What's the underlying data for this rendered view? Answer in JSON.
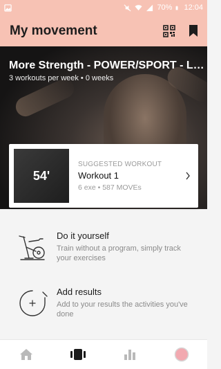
{
  "status_bar": {
    "battery": "70%",
    "time": "12:04",
    "icons": [
      "gallery-icon",
      "mute-icon",
      "wifi-icon",
      "signal-icon",
      "battery-icon"
    ]
  },
  "app_bar": {
    "title": "My movement",
    "actions": [
      "qr-code-icon",
      "bookmark-icon"
    ],
    "background": "#f7c2b4"
  },
  "program": {
    "title": "More Strength - POWER/SPORT - Le...",
    "subtitle": "3 workouts per week • 0 weeks"
  },
  "suggested_workout": {
    "duration": "54'",
    "label": "SUGGESTED WORKOUT",
    "name": "Workout 1",
    "meta": "6 exe • 587 MOVEs"
  },
  "options": [
    {
      "title": "Do it yourself",
      "description": "Train without a program, simply track your exercises",
      "icon": "exercise-bike-icon"
    },
    {
      "title": "Add results",
      "description": "Add to your results the activities you've done",
      "icon": "add-circle-icon"
    }
  ],
  "bottom_nav": {
    "items": [
      "home-icon",
      "movement-icon",
      "stats-icon",
      "profile-icon"
    ],
    "active": "movement-icon",
    "profile_color": "#f2a9b0"
  }
}
